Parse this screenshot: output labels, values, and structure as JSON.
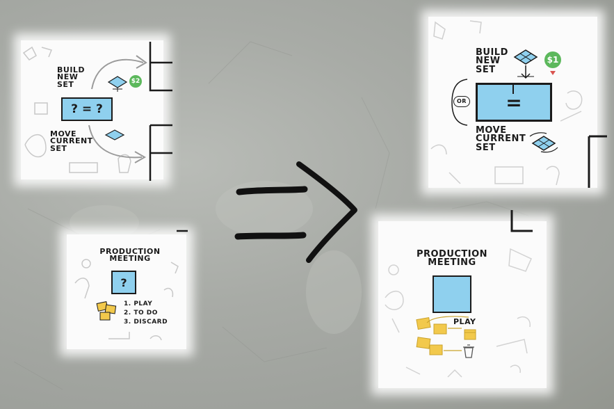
{
  "left_top_card": {
    "build_label": "BUILD NEW SET",
    "equation": "? = ?",
    "coin": "$2",
    "move_label": "MOVE CURRENT SET"
  },
  "left_bottom_card": {
    "title": "PRODUCTION MEETING",
    "box_symbol": "?",
    "steps": [
      "1. PLAY",
      "2. TO DO",
      "3. DISCARD"
    ]
  },
  "right_top_card": {
    "build_label": "BUILD NEW SET",
    "coin": "$1",
    "or_label": "OR",
    "equals": "=",
    "move_label": "MOVE CURRENT SET"
  },
  "right_bottom_card": {
    "title": "PRODUCTION MEETING",
    "play_label": "PLAY"
  },
  "arrow_icon": "implies-arrow-icon",
  "colors": {
    "background": "#a8aba6",
    "card": "#fbfbfb",
    "box_blue": "#8fd0ee",
    "coin_green": "#5cb85c",
    "token_yellow": "#f2c94c"
  }
}
